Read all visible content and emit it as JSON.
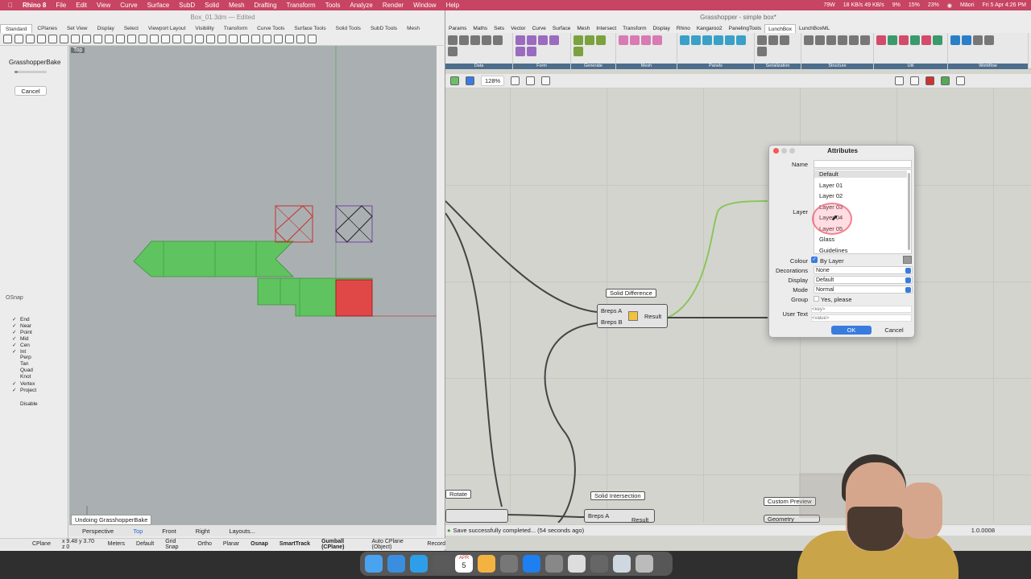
{
  "menubar": {
    "app": "Rhino 8",
    "items": [
      "File",
      "Edit",
      "View",
      "Curve",
      "Surface",
      "SubD",
      "Solid",
      "Mesh",
      "Drafting",
      "Transform",
      "Tools",
      "Analyze",
      "Render",
      "Window",
      "Help"
    ],
    "battery": "79W",
    "net": "18 KB/s 49 KB/s",
    "cpu1": "9%",
    "cpu2": "15%",
    "mem": "23%",
    "user": "Māori",
    "clock": "Fri 5 Apr 4:26 PM"
  },
  "rhino": {
    "title": "Box_01.3dm — Edited",
    "tabs": [
      "Standard",
      "CPlanes",
      "Set View",
      "Display",
      "Select",
      "Viewport Layout",
      "Visibility",
      "Transform",
      "Curve Tools",
      "Surface Tools",
      "Solid Tools",
      "SubD Tools",
      "Mesh"
    ],
    "bake_title": "GrasshopperBake",
    "bake_progress": 0.1,
    "cancel": "Cancel",
    "viewport_label": "Top",
    "osnap_title": "OSnap",
    "osnaps": [
      {
        "label": "End",
        "on": true
      },
      {
        "label": "Near",
        "on": true
      },
      {
        "label": "Point",
        "on": true
      },
      {
        "label": "Mid",
        "on": true
      },
      {
        "label": "Cen",
        "on": true
      },
      {
        "label": "Int",
        "on": true
      },
      {
        "label": "Perp",
        "on": false
      },
      {
        "label": "Tan",
        "on": false
      },
      {
        "label": "Quad",
        "on": false
      },
      {
        "label": "Knot",
        "on": false
      },
      {
        "label": "Vertex",
        "on": true
      },
      {
        "label": "Project",
        "on": true
      }
    ],
    "disable": "Disable",
    "undo_tip": "Undoing GrasshopperBake",
    "view_tabs": [
      "Perspective",
      "Top",
      "Front",
      "Right",
      "Layouts..."
    ],
    "active_view": "Top",
    "status": {
      "cplane": "CPlane",
      "coords": "x 9.48  y 3.70  z 0",
      "units": "Meters",
      "layer": "Default",
      "toggles": [
        "Grid Snap",
        "Ortho",
        "Planar",
        "Osnap",
        "SmartTrack",
        "Gumball (CPlane)",
        "Auto CPlane (Object)",
        "Record"
      ]
    }
  },
  "gh": {
    "title": "Grasshopper - simple box*",
    "tabs": [
      "Params",
      "Maths",
      "Sets",
      "Vector",
      "Curve",
      "Surface",
      "Mesh",
      "Intersect",
      "Transform",
      "Display",
      "Rhino",
      "Kangaroo2",
      "PanelingTools",
      "LunchBox",
      "LunchBoxML"
    ],
    "active_tab": "LunchBox",
    "groups": [
      "Data",
      "Form",
      "Generate",
      "Mesh",
      "Panels",
      "Serialization",
      "Structure",
      "Util",
      "Workflow"
    ],
    "zoom": "128%",
    "components": {
      "solid_difference": {
        "label": "Solid Difference",
        "in1": "Breps A",
        "in2": "Breps B",
        "out": "Result"
      },
      "solid_intersection": {
        "label": "Solid Intersection",
        "in1": "Breps A",
        "out": "Result"
      },
      "rotate": {
        "label": "Rotate"
      },
      "custom_preview": {
        "label": "Custom Preview",
        "in1": "Geometry"
      }
    },
    "status": "Save successfully completed... (54 seconds ago)",
    "version": "1.0.0008"
  },
  "attributes": {
    "title": "Attributes",
    "name_label": "Name",
    "layer_label": "Layer",
    "layers": [
      "Default",
      "Layer 01",
      "Layer 02",
      "Layer 03",
      "Layer 04",
      "Layer 05",
      "Glass",
      "Guidelines"
    ],
    "selected_layer": "Default",
    "colour_label": "Colour",
    "colour_value": "By Layer",
    "decorations_label": "Decorations",
    "decorations_value": "None",
    "display_label": "Display",
    "display_value": "Default",
    "mode_label": "Mode",
    "mode_value": "Normal",
    "group_label": "Group",
    "group_value": "Yes, please",
    "user_text_label": "User Text",
    "key_placeholder": "<key>",
    "value_placeholder": "<value>",
    "ok": "OK",
    "cancel": "Cancel"
  },
  "dock": {
    "calendar_month": "APR",
    "calendar_day": "5"
  },
  "colors": {
    "menubar": "#c74462",
    "viewport": "#aab0b2",
    "green_shape": "#5fc45f",
    "red_shape": "#e04848",
    "accent": "#3a7be0"
  }
}
